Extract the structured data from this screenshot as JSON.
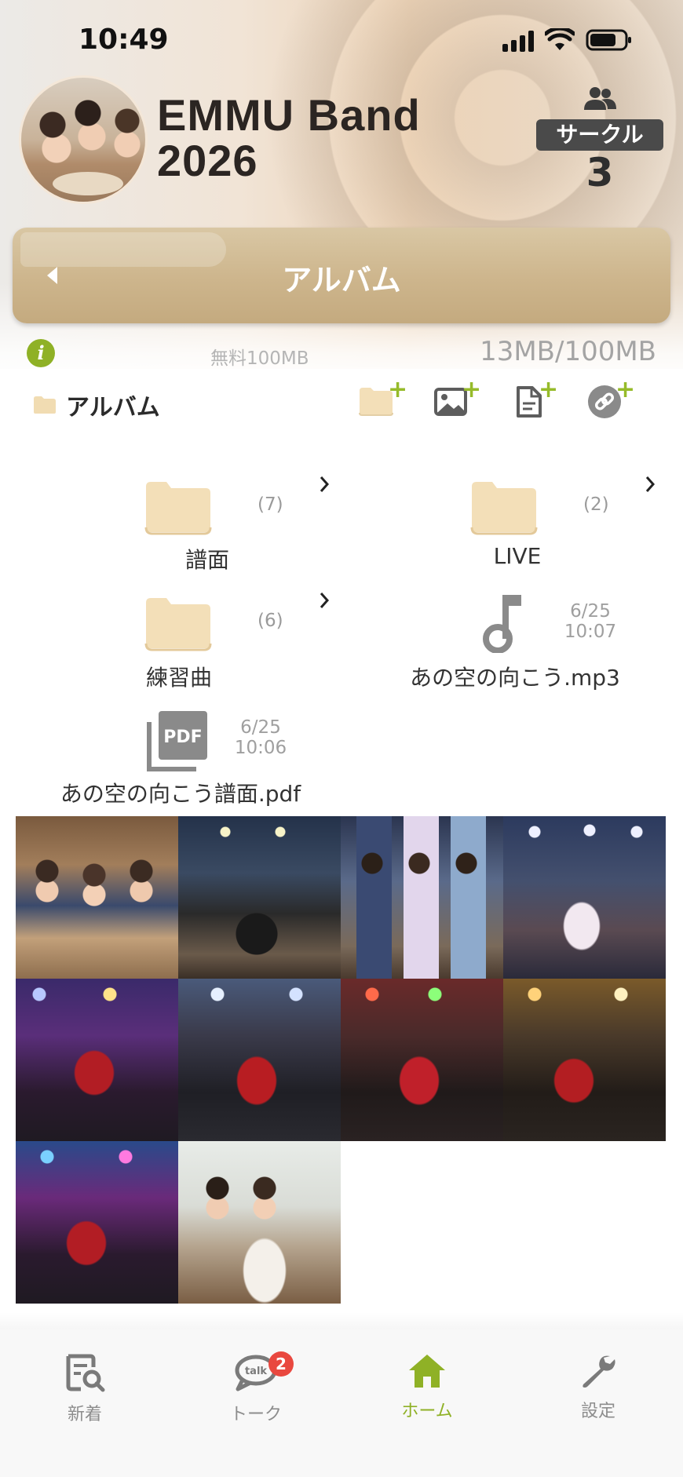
{
  "status_bar": {
    "time": "10:49"
  },
  "group": {
    "name_line1": "EMMU Band",
    "name_line2": "2026",
    "circle_label": "サークル",
    "circle_count": "3"
  },
  "album_bar": {
    "title": "アルバム"
  },
  "storage": {
    "plan": "無料100MB",
    "usage": "13MB/100MB",
    "used_mb": 13,
    "total_mb": 100
  },
  "path": {
    "label": "アルバム"
  },
  "actions": [
    {
      "icon": "add-folder-icon"
    },
    {
      "icon": "add-photo-icon"
    },
    {
      "icon": "add-document-icon"
    },
    {
      "icon": "add-link-icon"
    }
  ],
  "items": {
    "folder_score": {
      "name": "譜面",
      "count": "(7)"
    },
    "folder_live": {
      "name": "LIVE",
      "count": "(2)"
    },
    "folder_practice": {
      "name": "練習曲",
      "count": "(6)"
    },
    "file_mp3": {
      "name": "あの空の向こう.mp3",
      "date": "6/25",
      "time": "10:07"
    },
    "file_pdf": {
      "name": "あの空の向こう譜面.pdf",
      "date": "6/25",
      "time": "10:06",
      "badge": "PDF"
    }
  },
  "tabbar": {
    "tabs": [
      {
        "id": "new",
        "label": "新着",
        "icon": "news-search-icon"
      },
      {
        "id": "talk",
        "label": "トーク",
        "icon": "talk-bubble-icon",
        "bubble_text": "talk",
        "badge": "2"
      },
      {
        "id": "home",
        "label": "ホーム",
        "icon": "home-icon"
      },
      {
        "id": "settings",
        "label": "設定",
        "icon": "wrench-icon"
      }
    ]
  },
  "colors": {
    "accent_green": "#8fb126",
    "album_bar": "#cdb58c",
    "folder": "#f3dfb8",
    "badge_red": "#e9483f"
  }
}
